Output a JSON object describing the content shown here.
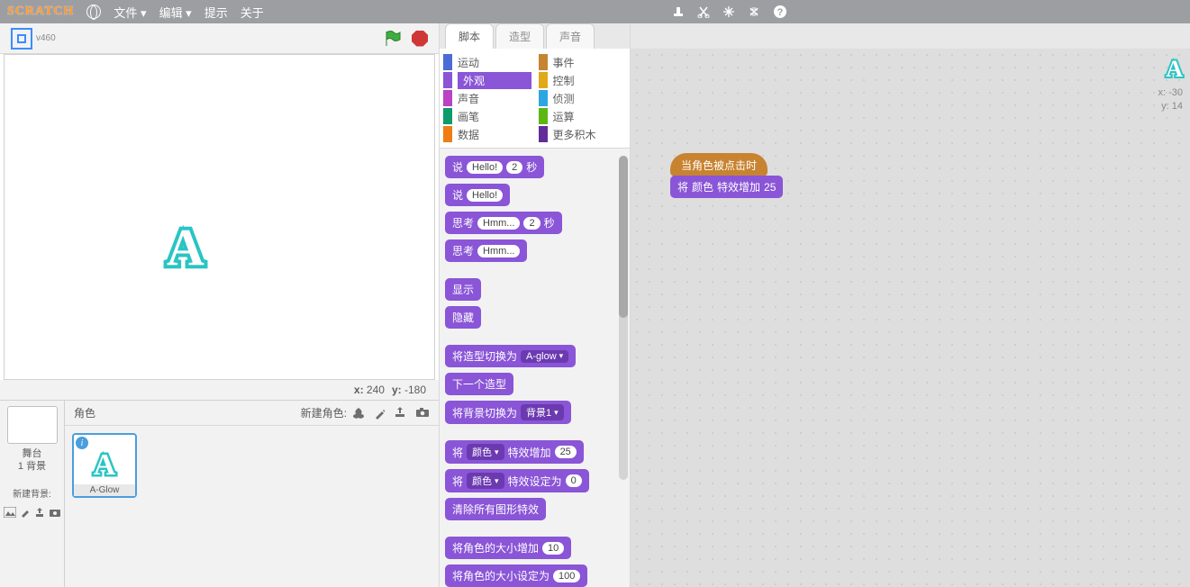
{
  "logo": "SCRATCH",
  "menu": {
    "file": "文件 ▾",
    "edit": "编辑 ▾",
    "tips": "提示",
    "about": "关于"
  },
  "stage": {
    "version": "v460",
    "footer_x_label": "x:",
    "footer_x": "240",
    "footer_y_label": "y:",
    "footer_y": "-180"
  },
  "sprite_area": {
    "title": "角色",
    "new_sprite_label": "新建角色:",
    "stage_label": "舞台",
    "stage_sub": "1 背景",
    "new_bg_label": "新建背景:",
    "sprite_name": "A-Glow"
  },
  "tabs": {
    "scripts": "脚本",
    "costumes": "造型",
    "sounds": "声音"
  },
  "categories": {
    "motion": "运动",
    "events": "事件",
    "looks": "外观",
    "control": "控制",
    "sound": "声音",
    "sensing": "侦测",
    "pen": "画笔",
    "operators": "运算",
    "data": "数据",
    "more": "更多积木"
  },
  "palette": {
    "say_for": {
      "a": "说",
      "b": "Hello!",
      "c": "2",
      "d": "秒"
    },
    "say": {
      "a": "说",
      "b": "Hello!"
    },
    "think_for": {
      "a": "思考",
      "b": "Hmm...",
      "c": "2",
      "d": "秒"
    },
    "think": {
      "a": "思考",
      "b": "Hmm..."
    },
    "show": "显示",
    "hide": "隐藏",
    "switch_costume": {
      "a": "将造型切换为",
      "b": "A-glow"
    },
    "next_costume": "下一个造型",
    "switch_backdrop": {
      "a": "将背景切换为",
      "b": "背景1"
    },
    "change_effect": {
      "a": "将",
      "b": "颜色",
      "c": "特效增加",
      "d": "25"
    },
    "set_effect": {
      "a": "将",
      "b": "颜色",
      "c": "特效设定为",
      "d": "0"
    },
    "clear_effects": "清除所有图形特效",
    "change_size": {
      "a": "将角色的大小增加",
      "b": "10"
    },
    "set_size": {
      "a": "将角色的大小设定为",
      "b": "100"
    }
  },
  "script": {
    "hat": "当角色被点击时",
    "b1": {
      "a": "将",
      "b": "颜色",
      "c": "特效增加",
      "d": "25"
    }
  },
  "readout": {
    "x_label": "x:",
    "x": "-30",
    "y_label": "y:",
    "y": "14"
  }
}
